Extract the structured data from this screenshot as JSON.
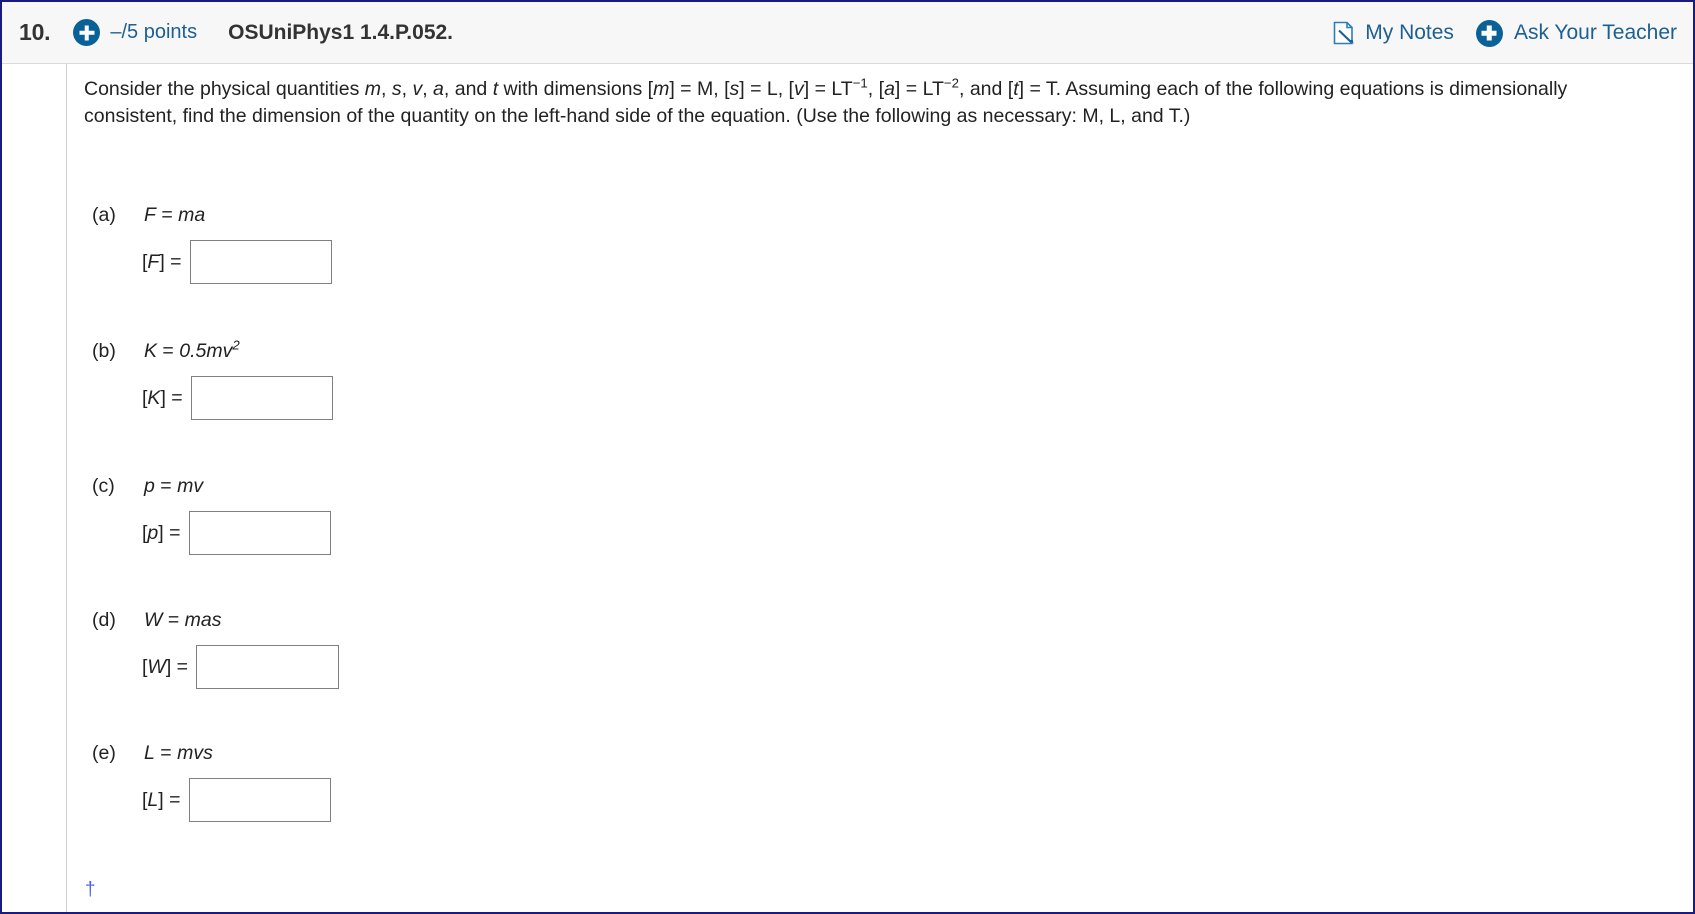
{
  "header": {
    "question_number": "10.",
    "points": "–/5 points",
    "question_code": "OSUniPhys1 1.4.P.052.",
    "my_notes_label": "My Notes",
    "ask_teacher_label": "Ask Your Teacher",
    "add_icon": "plus-circle-icon",
    "notes_icon": "note-pencil-icon",
    "accent_blue": "#1d5f92",
    "icon_blue": "#0a6198",
    "header_bg": "#f7f7f7",
    "page_border": "#1a1a80"
  },
  "stem": {
    "line1_a": "Consider the physical quantities ",
    "var_m": "m",
    "sep1": ", ",
    "var_s": "s",
    "sep2": ", ",
    "var_v": "v",
    "sep3": ", ",
    "var_a": "a",
    "sep4": ", and ",
    "var_t": "t",
    "mid1": " with dimensions [",
    "dim_m_var": "m",
    "dim_m_val": "] = M, [",
    "dim_s_var": "s",
    "dim_s_val": "] = L, [",
    "dim_v_var": "v",
    "dim_v_val": "] = LT",
    "dim_v_exp": "−1",
    "dim_a_open": ", [",
    "dim_a_var": "a",
    "dim_a_val": "] = LT",
    "dim_a_exp": "−2",
    "dim_t_open": ", and [",
    "dim_t_var": "t",
    "dim_t_val": "] = T. Assuming each of the following equations is dimensionally consistent, find the dimension of the quantity on the left-hand side of the equation. (Use the following as necessary: M, L, and T.)"
  },
  "parts": [
    {
      "label": "(a)",
      "eq_lhs": "F",
      "eq_op": " = ",
      "eq_rhs": "ma",
      "eq_exp": "",
      "answer_open": "[",
      "answer_var": "F",
      "answer_close": "] =",
      "answer_value": "",
      "answer_placeholder": ""
    },
    {
      "label": "(b)",
      "eq_lhs": "K",
      "eq_op": " = ",
      "eq_rhs": "0.5mv",
      "eq_exp": "2",
      "answer_open": "[",
      "answer_var": "K",
      "answer_close": "] =",
      "answer_value": "",
      "answer_placeholder": ""
    },
    {
      "label": "(c)",
      "eq_lhs": "p",
      "eq_op": " = ",
      "eq_rhs": "mv",
      "eq_exp": "",
      "answer_open": "[",
      "answer_var": "p",
      "answer_close": "] =",
      "answer_value": "",
      "answer_placeholder": ""
    },
    {
      "label": "(d)",
      "eq_lhs": "W",
      "eq_op": " = ",
      "eq_rhs": "mas",
      "eq_exp": "",
      "answer_open": "[",
      "answer_var": "W",
      "answer_close": "] =",
      "answer_value": "",
      "answer_placeholder": ""
    },
    {
      "label": "(e)",
      "eq_lhs": "L",
      "eq_op": " = ",
      "eq_rhs": "mvs",
      "eq_exp": "",
      "answer_open": "[",
      "answer_var": "L",
      "answer_close": "] =",
      "answer_value": "",
      "answer_placeholder": ""
    }
  ],
  "footer": {
    "dagger": "†"
  }
}
